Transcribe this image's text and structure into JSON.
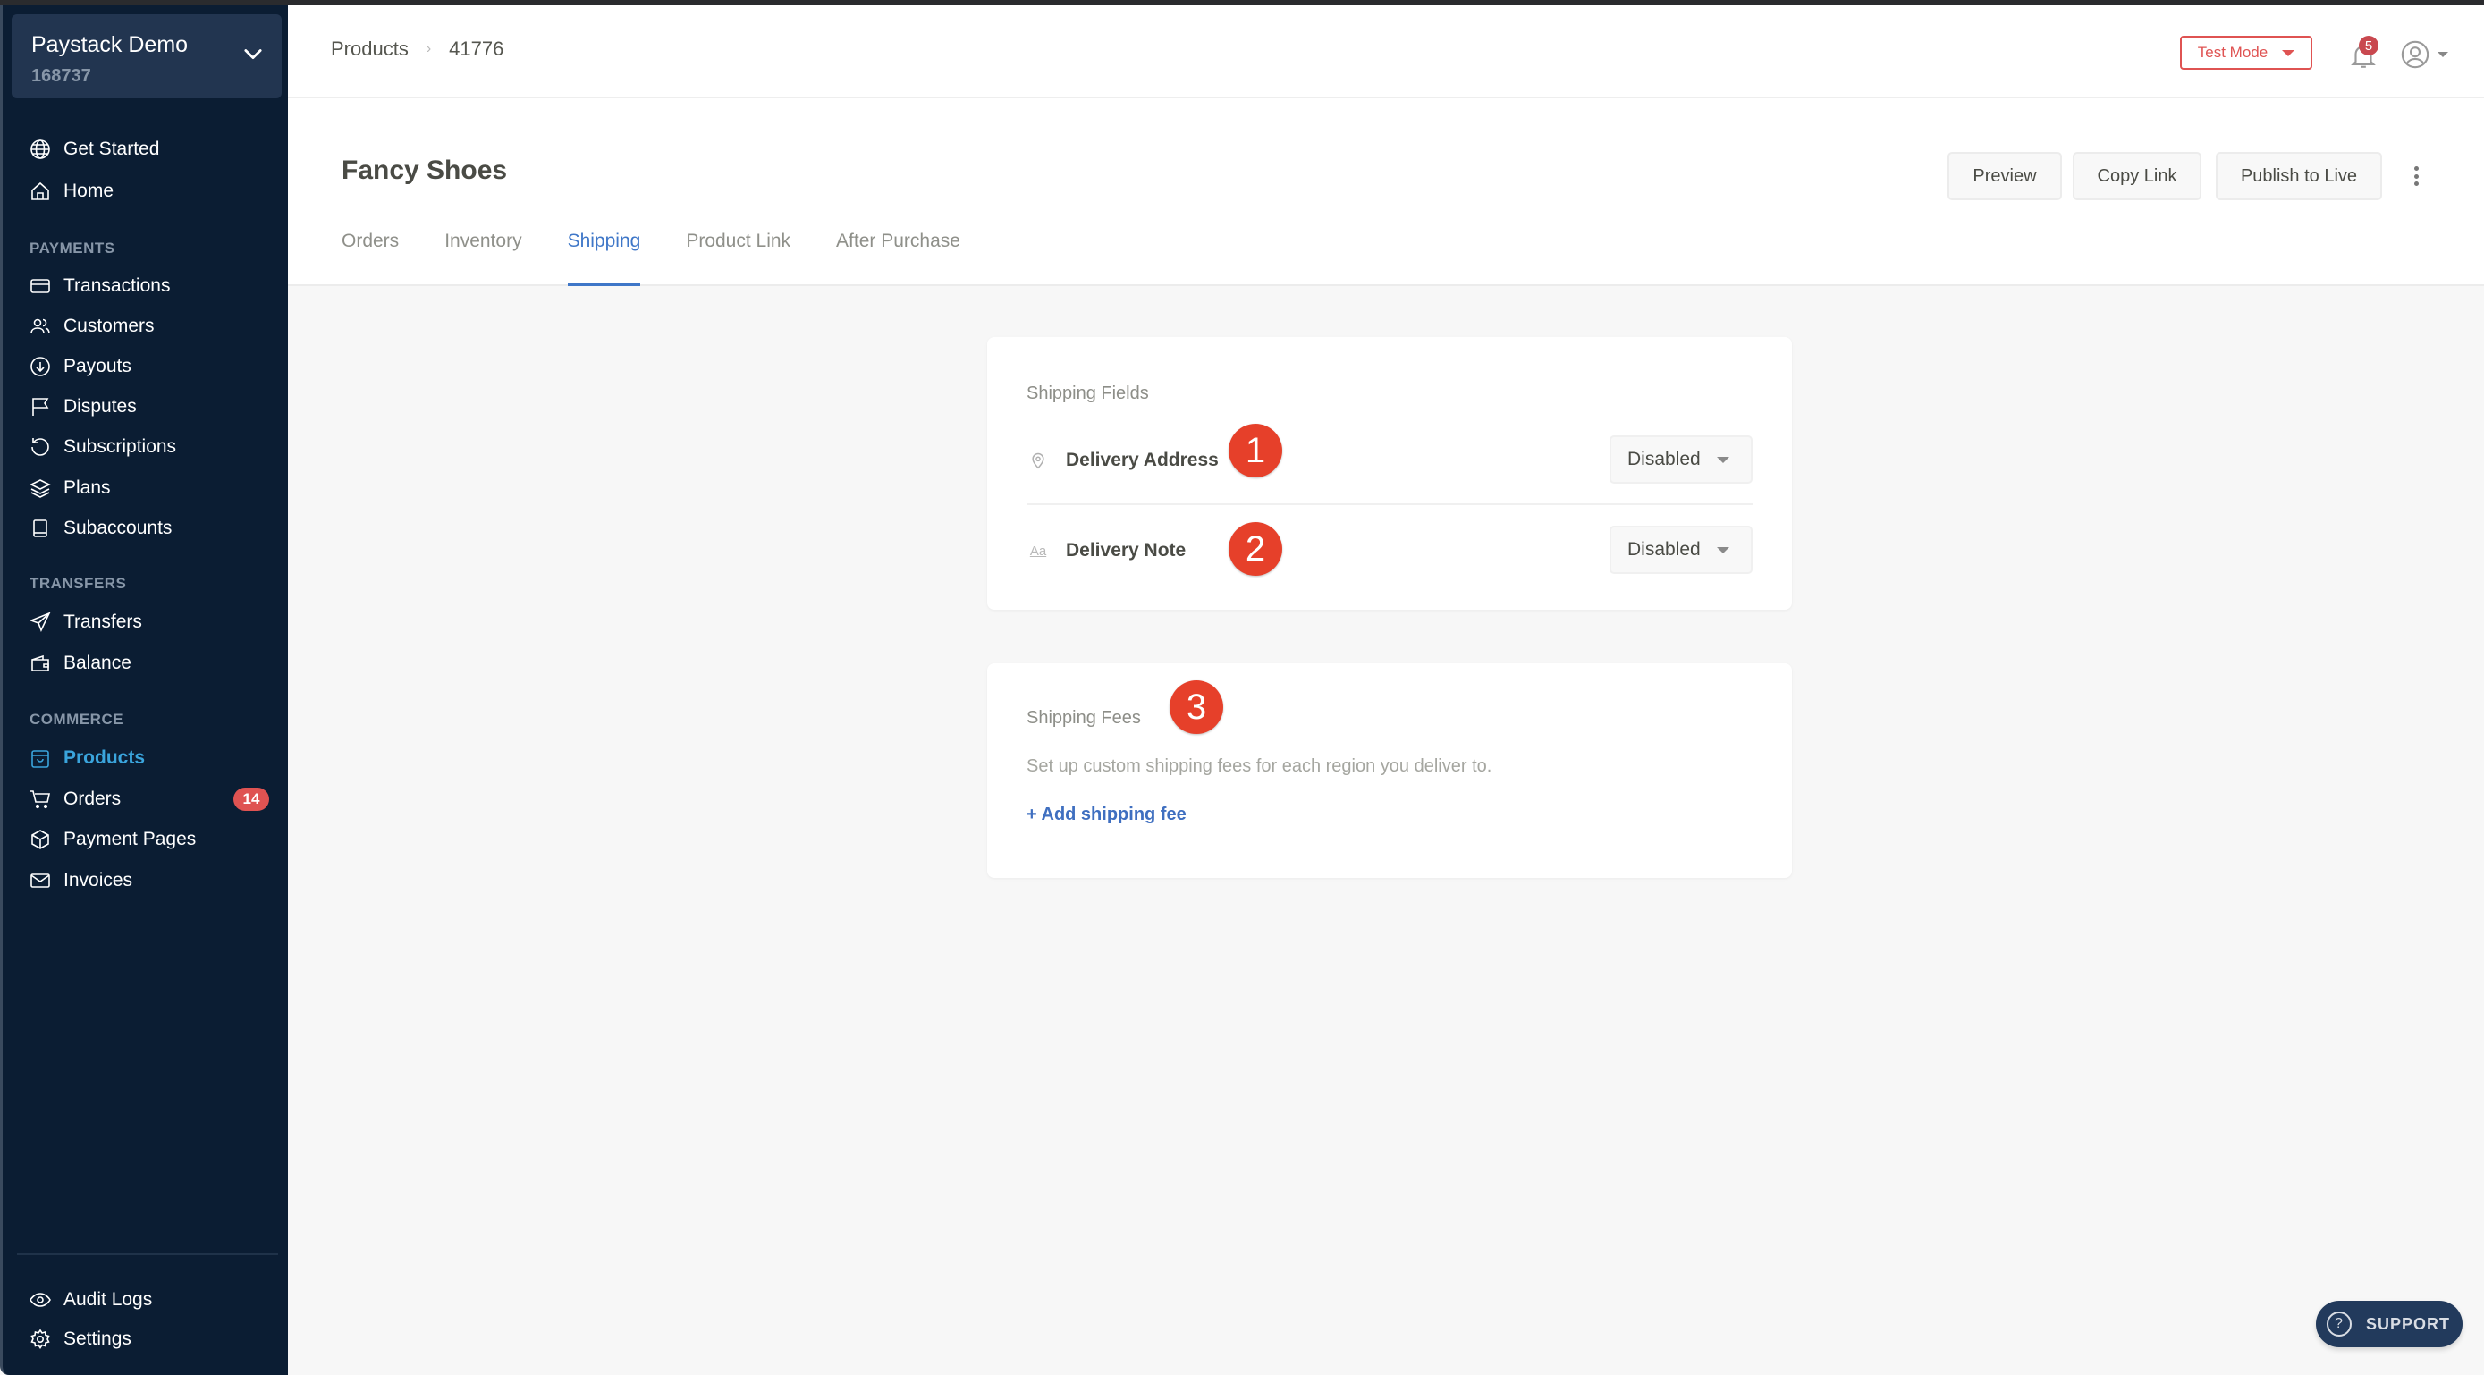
{
  "account": {
    "name": "Paystack Demo",
    "id": "168737"
  },
  "sidebar": {
    "top_items": [
      {
        "label": "Get Started",
        "icon": "globe-icon"
      },
      {
        "label": "Home",
        "icon": "home-icon"
      }
    ],
    "sections": [
      {
        "title": "PAYMENTS",
        "items": [
          {
            "label": "Transactions",
            "icon": "card-icon"
          },
          {
            "label": "Customers",
            "icon": "users-icon"
          },
          {
            "label": "Payouts",
            "icon": "arrow-down-circle-icon"
          },
          {
            "label": "Disputes",
            "icon": "flag-icon"
          },
          {
            "label": "Subscriptions",
            "icon": "refresh-icon"
          },
          {
            "label": "Plans",
            "icon": "layers-icon"
          },
          {
            "label": "Subaccounts",
            "icon": "book-icon"
          }
        ]
      },
      {
        "title": "TRANSFERS",
        "items": [
          {
            "label": "Transfers",
            "icon": "send-icon"
          },
          {
            "label": "Balance",
            "icon": "wallet-icon"
          }
        ]
      },
      {
        "title": "COMMERCE",
        "items": [
          {
            "label": "Products",
            "icon": "shopping-bag-icon",
            "active": true
          },
          {
            "label": "Orders",
            "icon": "cart-icon",
            "badge": "14"
          },
          {
            "label": "Payment Pages",
            "icon": "box-icon"
          },
          {
            "label": "Invoices",
            "icon": "mail-icon"
          }
        ]
      }
    ],
    "bottom_items": [
      {
        "label": "Audit Logs",
        "icon": "eye-icon"
      },
      {
        "label": "Settings",
        "icon": "gear-icon"
      }
    ]
  },
  "header": {
    "breadcrumb": [
      "Products",
      "41776"
    ],
    "mode_label": "Test Mode",
    "notification_count": "5"
  },
  "page": {
    "title": "Fancy Shoes",
    "actions": [
      "Preview",
      "Copy Link",
      "Publish to Live"
    ],
    "tabs": [
      {
        "label": "Orders"
      },
      {
        "label": "Inventory"
      },
      {
        "label": "Shipping",
        "active": true
      },
      {
        "label": "Product Link"
      },
      {
        "label": "After Purchase"
      }
    ]
  },
  "shipping_fields": {
    "title": "Shipping Fields",
    "fields": [
      {
        "label": "Delivery Address",
        "icon": "location-pin-icon",
        "value": "Disabled",
        "marker": "1"
      },
      {
        "label": "Delivery Note",
        "icon": "text-format-icon",
        "value": "Disabled",
        "marker": "2"
      }
    ]
  },
  "shipping_fees": {
    "title": "Shipping Fees",
    "marker": "3",
    "description": "Set up custom shipping fees for each region you deliver to.",
    "add_label": "+ Add shipping fee"
  },
  "support_label": "SUPPORT",
  "colors": {
    "accent": "#3f77c8",
    "sidebar": "#0b1d33",
    "active_nav": "#3aa4dc",
    "danger": "#df5352",
    "marker": "#e6402a"
  }
}
